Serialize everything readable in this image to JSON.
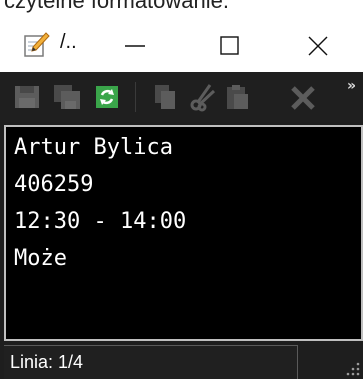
{
  "caption_top": "czytelne formatowanie.",
  "window": {
    "title": "/..",
    "icon": "notepad-pencil-icon",
    "controls": [
      "minimize-icon",
      "maximize-icon",
      "close-icon"
    ]
  },
  "toolbar": {
    "buttons": [
      "save-icon",
      "save-as-icon",
      "reload-icon",
      "copy-icon",
      "cut-icon",
      "paste-icon",
      "delete-icon"
    ],
    "more_label": "»"
  },
  "editor": {
    "lines": [
      "Artur Bylica",
      "406259",
      "12:30 - 14:00",
      "Może"
    ]
  },
  "status": {
    "position": "Linia: 1/4"
  },
  "colors": {
    "toolbar_bg": "#1f1f1f",
    "editor_bg": "#000000",
    "icon_gray": "#5c5c5c",
    "reload_green": "#3aa54a"
  }
}
